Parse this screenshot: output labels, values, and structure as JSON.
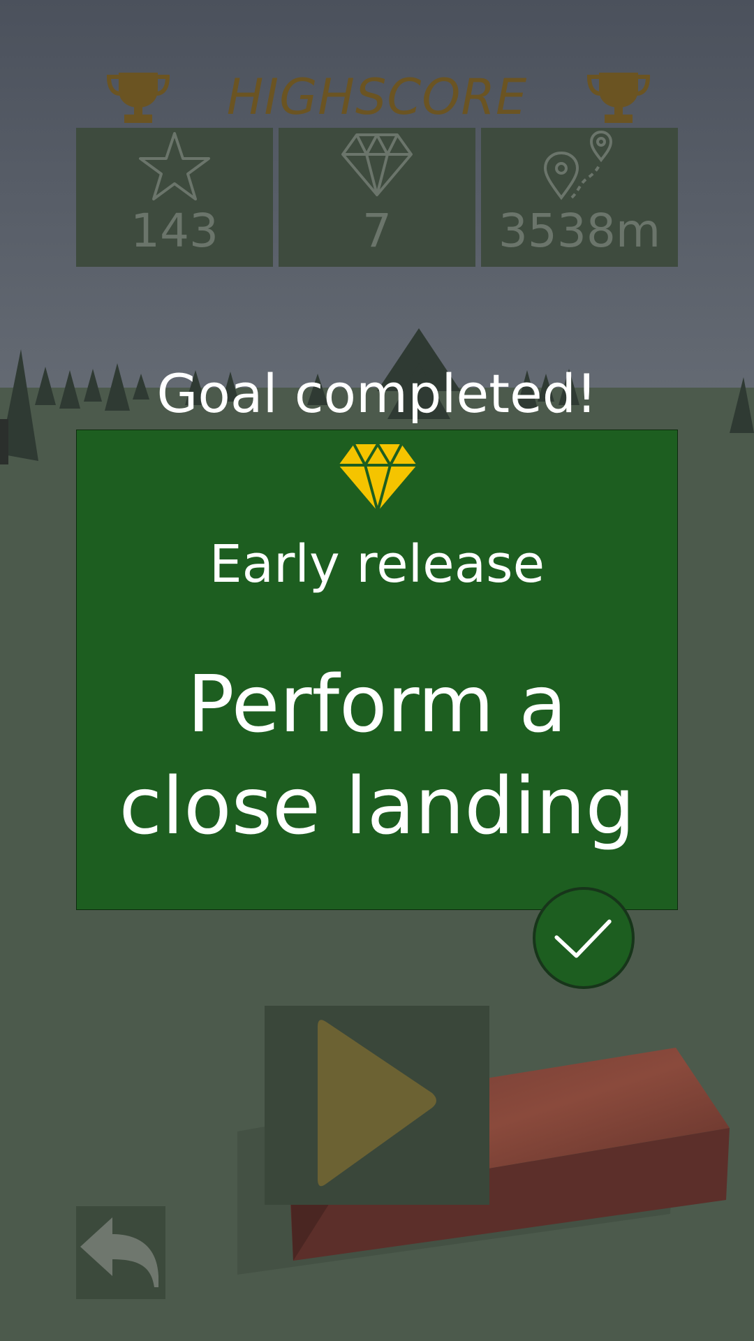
{
  "colors": {
    "sky_top": "#4b515c",
    "sky_bottom": "#5f6671",
    "ground": "#4b5a4c",
    "stat_box": "#3e4b3e",
    "highscore_gold": "#6b5422",
    "stat_text": "#6b756b",
    "card_green": "#1d5e20",
    "diamond_yellow": "#f5c400",
    "play_box": "#3a473a",
    "play_triangle": "#6c6233",
    "back_box": "#3c4a3c",
    "back_arrow": "#6f776e",
    "wood": "#7a3a30"
  },
  "highscore": {
    "title": "HIGHSCORE",
    "stats": [
      {
        "icon": "star-icon",
        "value": "143"
      },
      {
        "icon": "diamond-icon",
        "value": "7"
      },
      {
        "icon": "distance-pin-icon",
        "value": "3538m"
      }
    ]
  },
  "goal": {
    "heading": "Goal completed!",
    "icon": "diamond-icon",
    "subtitle": "Early release",
    "description_line1": "Perform a",
    "description_line2": "close landing",
    "status_icon": "checkmark-icon"
  },
  "controls": {
    "play_icon": "play-icon",
    "back_icon": "back-arrow-icon"
  }
}
